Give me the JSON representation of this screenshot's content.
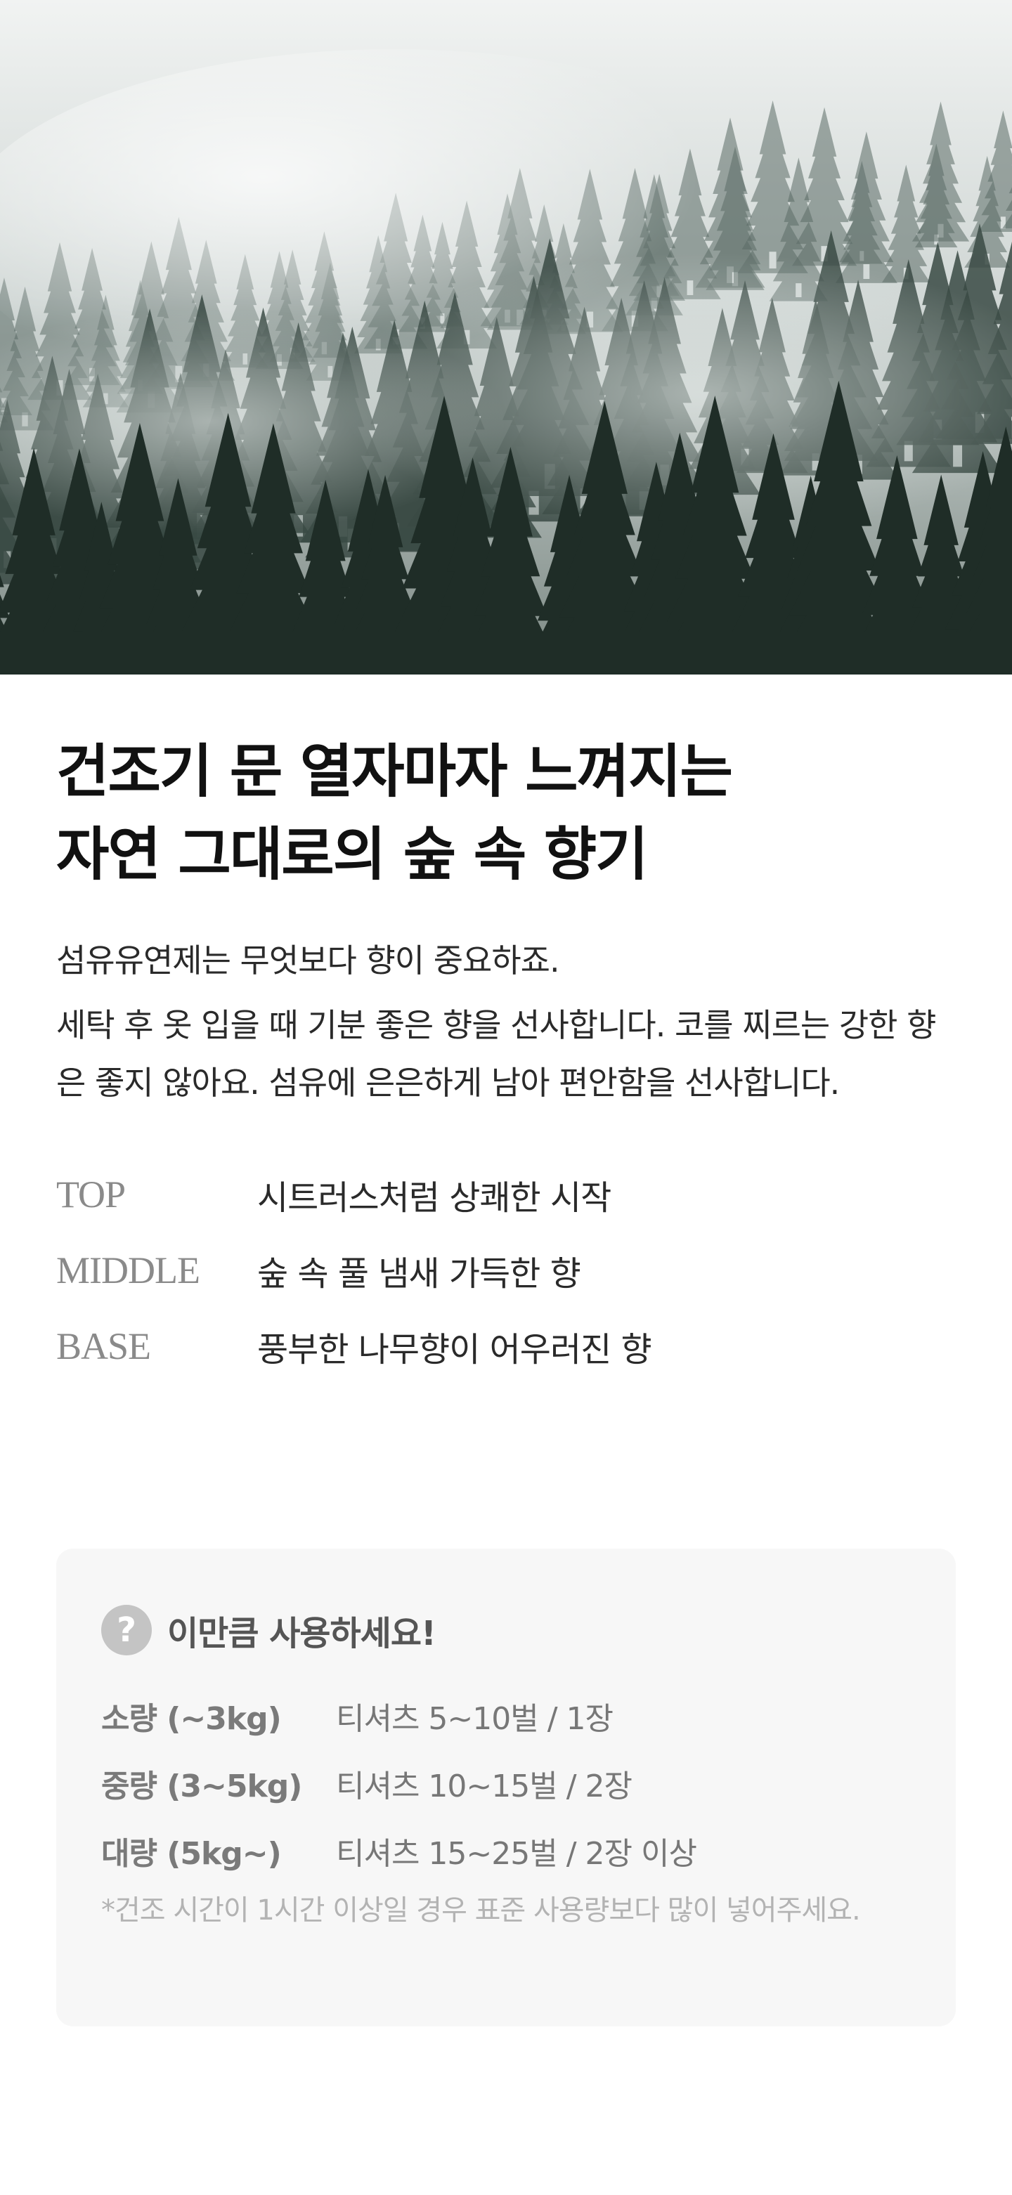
{
  "hero": {
    "image_description": "misty pine forest",
    "colors": {
      "sky": "#e6eaea",
      "fog": "#c9d0cf",
      "forest_far": "#5b6b66",
      "forest_mid": "#3a4a44",
      "forest_near": "#1f2d27"
    }
  },
  "headline": {
    "line1": "건조기 문 열자마자 느껴지는",
    "line2": "자연 그대로의 숲 속 향기"
  },
  "intro": "섬유유연제는 무엇보다 향이 중요하죠.",
  "body": "세탁 후 옷 입을 때 기분 좋은 향을 선사합니다. 코를 찌르는 강한 향은 좋지 않아요. 섬유에 은은하게 남아 편안함을 선사합니다.",
  "notes": [
    {
      "label": "TOP",
      "desc": "시트러스처럼 상쾌한 시작"
    },
    {
      "label": "MIDDLE",
      "desc": "숲 속 풀 냄새 가득한 향"
    },
    {
      "label": "BASE",
      "desc": "풍부한 나무향이 어우러진 향"
    }
  ],
  "usage": {
    "icon": "question-icon",
    "title": "이만큼 사용하세요!",
    "rows": [
      {
        "amount": "소량 (~3kg)",
        "detail": "티셔츠 5~10벌 / 1장"
      },
      {
        "amount": "중량 (3~5kg)",
        "detail": "티셔츠 10~15벌 / 2장"
      },
      {
        "amount": "대량 (5kg~)",
        "detail": "티셔츠 15~25벌 / 2장 이상"
      }
    ],
    "footnote": "*건조 시간이 1시간 이상일 경우 표준 사용량보다 많이 넣어주세요."
  }
}
